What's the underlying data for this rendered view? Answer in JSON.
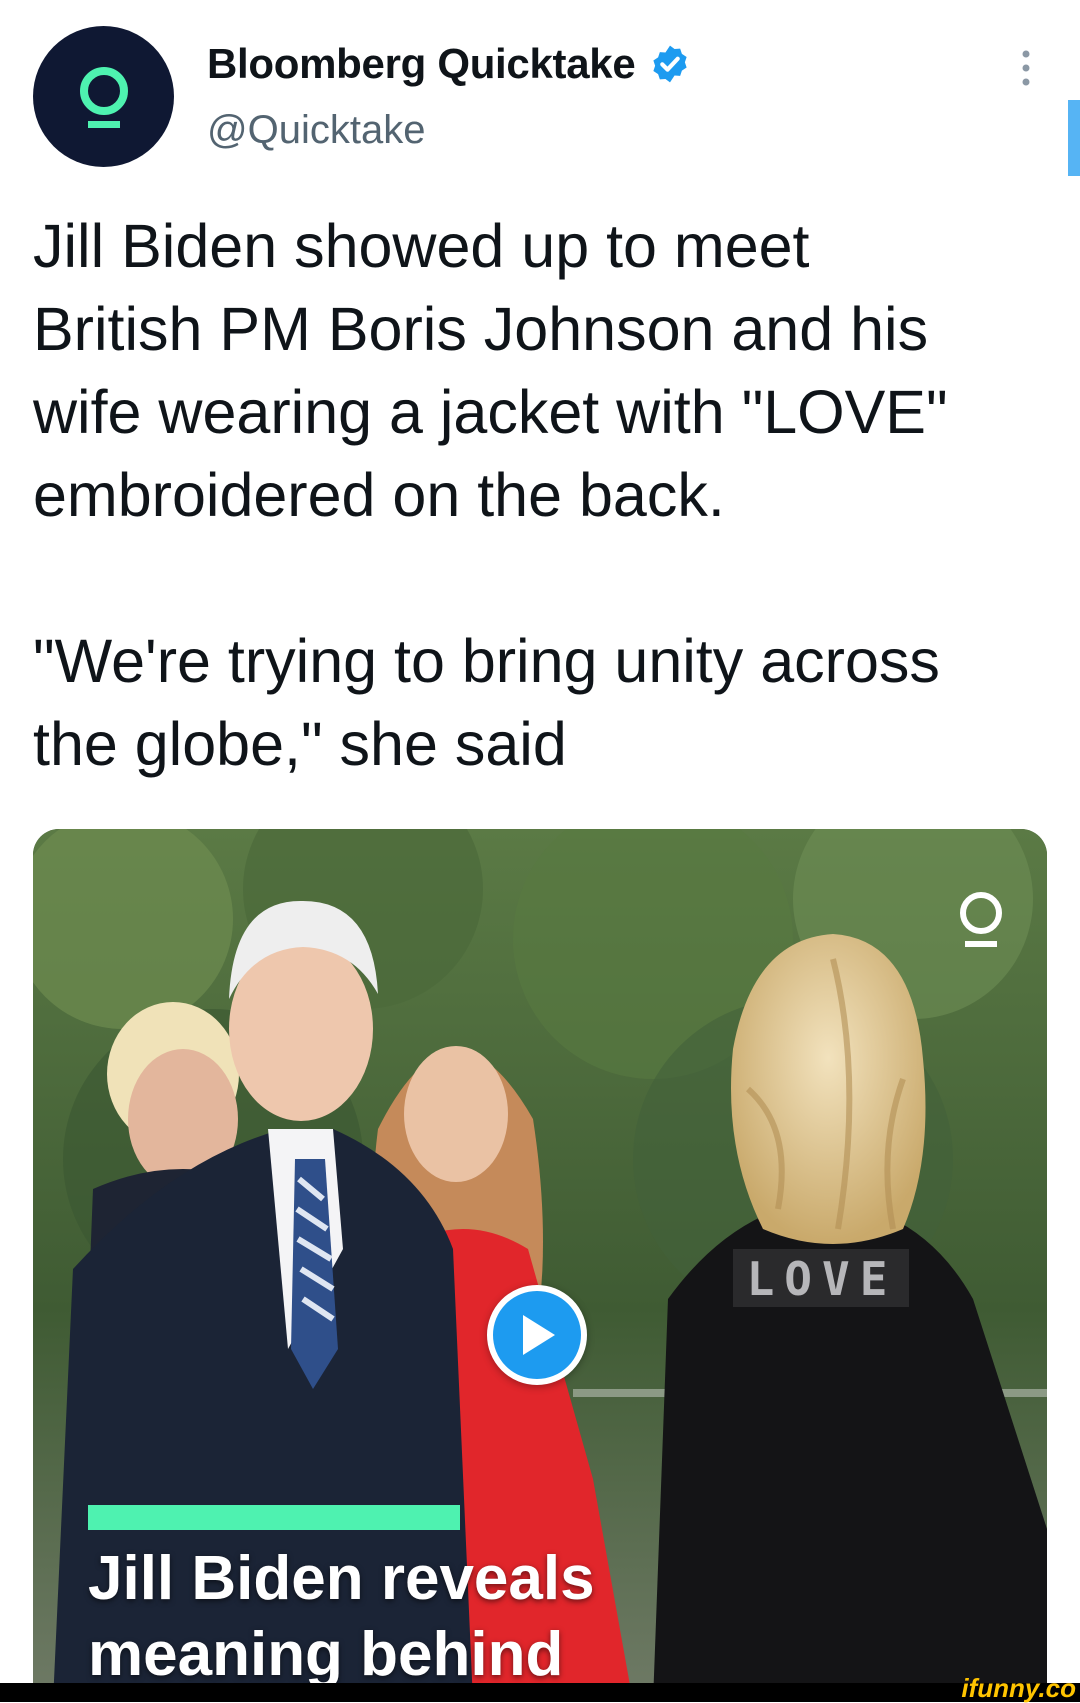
{
  "tweet": {
    "display_name": "Bloomberg Quicktake",
    "handle": "@Quicktake",
    "verified": true,
    "avatar_icon": "quicktake-logo-icon",
    "avatar_bg": "#0f1833",
    "avatar_accent": "#4ef2b0",
    "more_icon": "more-vertical-icon",
    "text_lines": [
      "Jill Biden showed up to meet",
      "British PM Boris Johnson and his",
      "wife wearing a jacket with \"LOVE\"",
      "embroidered on the back."
    ],
    "quote_lines": [
      "\"We're trying to bring unity across",
      "the globe,\" she said"
    ]
  },
  "media": {
    "type": "video",
    "play_icon": "play-icon",
    "logo_icon": "quicktake-logo-icon",
    "caption_lines": [
      "Jill Biden reveals",
      "meaning behind"
    ],
    "accent": "#4ef2b0",
    "jacket_text": "LOVE"
  },
  "watermark": "ifunny.co",
  "colors": {
    "verified": "#1d9bf0",
    "play_button": "#1d9bf0",
    "handle": "#536471"
  }
}
